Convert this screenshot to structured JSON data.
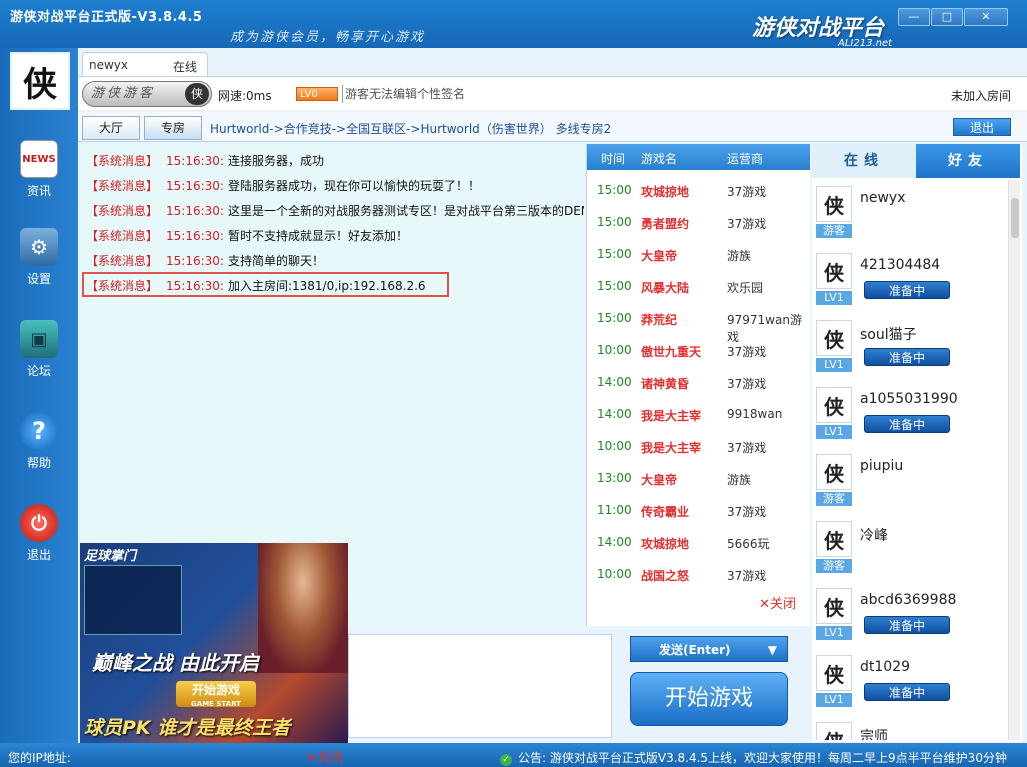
{
  "window": {
    "title": "游侠对战平台正式版-V3.8.4.5",
    "slogan": "成为游侠会员，畅享开心游戏",
    "brand": "游侠对战平台",
    "brand_sub": "ALI213.net",
    "minimize": "—",
    "maximize": "□",
    "close": "✕"
  },
  "leftnav": {
    "avatar_glyph": "侠",
    "items": [
      {
        "label": "资讯",
        "icon": "NEWS"
      },
      {
        "label": "设置",
        "icon": "⚙"
      },
      {
        "label": "论坛",
        "icon": "▣"
      },
      {
        "label": "帮助",
        "icon": "?"
      },
      {
        "label": "退出",
        "icon": "⏻"
      }
    ]
  },
  "user": {
    "name": "newyx",
    "online": "在线",
    "guest_label": "游侠游客",
    "guest_icon": "侠",
    "netspeed": "网速:0ms",
    "level": "LV0",
    "signature": "游客无法编辑个性签名",
    "room_status": "未加入房间"
  },
  "nav": {
    "tab_hall": "大厅",
    "tab_room": "专房",
    "breadcrumb": "Hurtworld->合作竞技->全国互联区->Hurtworld（伤害世界） 多线专房2",
    "exit": "退出"
  },
  "messages": [
    {
      "tag": "【系统消息】",
      "time": "15:16:30:",
      "text": "连接服务器，成功"
    },
    {
      "tag": "【系统消息】",
      "time": "15:16:30:",
      "text": "登陆服务器成功，现在你可以愉快的玩耍了！！"
    },
    {
      "tag": "【系统消息】",
      "time": "15:16:30:",
      "text": "这里是一个全新的对战服务器测试专区！是对战平台第三版本的DEMO"
    },
    {
      "tag": "【系统消息】",
      "time": "15:16:30:",
      "text": "暂时不支持成就显示！好友添加！"
    },
    {
      "tag": "【系统消息】",
      "time": "15:16:30:",
      "text": "支持简单的聊天！"
    },
    {
      "tag": "【系统消息】",
      "time": "15:16:30:",
      "text": "加入主房间:1381/0,ip:192.168.2.6"
    }
  ],
  "schedule": {
    "headers": [
      "时间",
      "游戏名",
      "运营商"
    ],
    "rows": [
      {
        "time": "15:00",
        "name": "攻城掠地",
        "op": "37游戏"
      },
      {
        "time": "15:00",
        "name": "勇者盟约",
        "op": "37游戏"
      },
      {
        "time": "15:00",
        "name": "大皇帝",
        "op": "游族"
      },
      {
        "time": "15:00",
        "name": "风暴大陆",
        "op": "欢乐园"
      },
      {
        "time": "15:00",
        "name": "莽荒纪",
        "op": "97971wan游戏"
      },
      {
        "time": "10:00",
        "name": "傲世九重天",
        "op": "37游戏"
      },
      {
        "time": "14:00",
        "name": "诸神黄昏",
        "op": "37游戏"
      },
      {
        "time": "14:00",
        "name": "我是大主宰",
        "op": "9918wan"
      },
      {
        "time": "10:00",
        "name": "我是大主宰",
        "op": "37游戏"
      },
      {
        "time": "13:00",
        "name": "大皇帝",
        "op": "游族"
      },
      {
        "time": "11:00",
        "name": "传奇霸业",
        "op": "37游戏"
      },
      {
        "time": "14:00",
        "name": "攻城掠地",
        "op": "5666玩"
      },
      {
        "time": "10:00",
        "name": "战国之怒",
        "op": "37游戏"
      }
    ],
    "close": "✕关闭"
  },
  "rightpanel": {
    "tab_online": "在线",
    "tab_friends": "好友",
    "users": [
      {
        "name": "newyx",
        "badge": "游客",
        "status": ""
      },
      {
        "name": "421304484",
        "badge": "LV1",
        "status": "准备中"
      },
      {
        "name": "soul猫子",
        "badge": "LV1",
        "status": "准备中"
      },
      {
        "name": "a1055031990",
        "badge": "LV1",
        "status": "准备中"
      },
      {
        "name": "piupiu",
        "badge": "游客",
        "status": ""
      },
      {
        "name": "冷峰",
        "badge": "游客",
        "status": ""
      },
      {
        "name": "abcd6369988",
        "badge": "LV1",
        "status": "准备中"
      },
      {
        "name": "dt1029",
        "badge": "LV1",
        "status": "准备中"
      },
      {
        "name": "宗师",
        "badge": "",
        "status": ""
      }
    ],
    "avatar_glyph": "侠"
  },
  "composer": {
    "send": "发送(Enter)",
    "send_arrow": "▼",
    "start": "开始游戏"
  },
  "ad": {
    "title": "足球掌门",
    "slogan": "巅峰之战 由此开启",
    "start": "开始游戏",
    "start_sub": "GAME START",
    "bottom": "球员PK 谁才是最终王者",
    "close": "✕关闭"
  },
  "statusbar": {
    "ip_label": "您的IP地址:",
    "notice": "公告: 游侠对战平台正式版V3.8.4.5上线，欢迎大家使用！每周二早上9点半平台维护30分钟"
  }
}
